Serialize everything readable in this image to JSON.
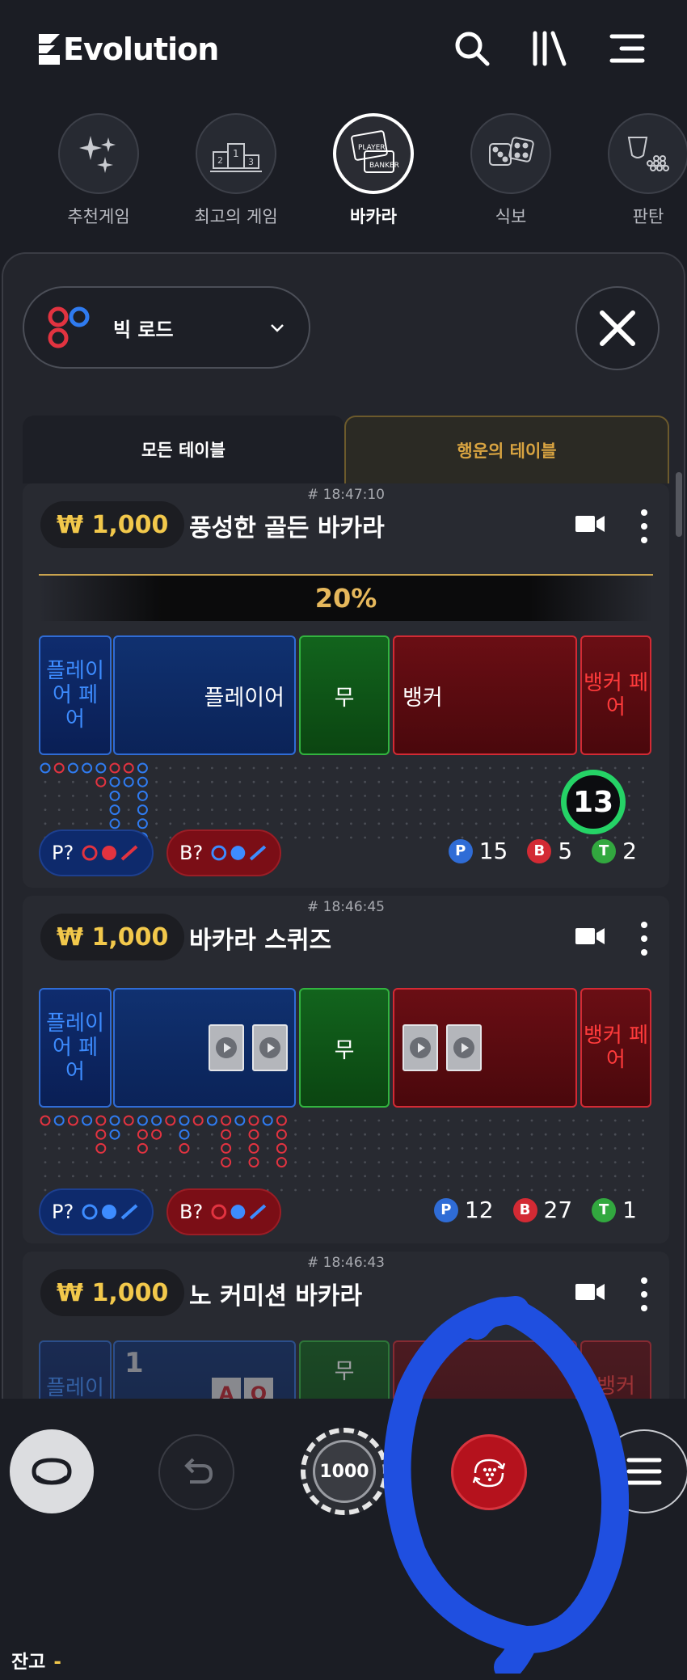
{
  "header": {
    "brand": "Evolution",
    "icons": [
      "search-icon",
      "library-icon",
      "menu-icon"
    ]
  },
  "categories": [
    {
      "label": "추천게임",
      "icon": "sparkles-icon",
      "active": false
    },
    {
      "label": "최고의 게임",
      "icon": "podium-icon",
      "active": false
    },
    {
      "label": "바카라",
      "icon": "baccarat-icon",
      "active": true
    },
    {
      "label": "식보",
      "icon": "dice-icon",
      "active": false
    },
    {
      "label": "판탄",
      "icon": "fantan-icon",
      "active": false
    }
  ],
  "road_selector": {
    "label": "빅 로드"
  },
  "tabs": {
    "all": "모든 테이블",
    "lucky": "행운의 테이블"
  },
  "tables": [
    {
      "time": "# 18:47:10",
      "stake": "₩ 1,000",
      "name": "풍성한 골든 바카라",
      "promo": "20%",
      "bets": {
        "player_pair": "플레이어 페어",
        "player": "플레이어",
        "tie": "무",
        "banker": "뱅커",
        "banker_pair": "뱅커 페어"
      },
      "timer": "13",
      "ask_player": "P?",
      "ask_banker": "B?",
      "counts": {
        "p_badge": "P",
        "p": "15",
        "b_badge": "B",
        "b": "5",
        "t_badge": "T",
        "t": "2"
      }
    },
    {
      "time": "# 18:46:45",
      "stake": "₩ 1,000",
      "name": "바카라 스퀴즈",
      "bets": {
        "player_pair": "플레이어 페어",
        "tie": "무",
        "banker_pair": "뱅커 페어"
      },
      "ask_player": "P?",
      "ask_banker": "B?",
      "counts": {
        "p_badge": "P",
        "p": "12",
        "b_badge": "B",
        "b": "27",
        "t_badge": "T",
        "t": "1"
      }
    },
    {
      "time": "# 18:46:43",
      "stake": "₩ 1,000",
      "name": "노 커미션 바카라",
      "bets": {
        "player_pair": "플레이 어",
        "player_value": "1",
        "tie": "무",
        "banker_pair": "뱅커"
      },
      "cards": [
        "A",
        "Q"
      ]
    }
  ],
  "toolbar": {
    "chip_value": "1000",
    "balance_label": "잔고",
    "balance_value": "-"
  },
  "colors": {
    "player": "#2f6cd6",
    "banker": "#d32a34",
    "tie": "#32b43f",
    "gold": "#f2c84b",
    "annotation": "#1f4fe0"
  }
}
